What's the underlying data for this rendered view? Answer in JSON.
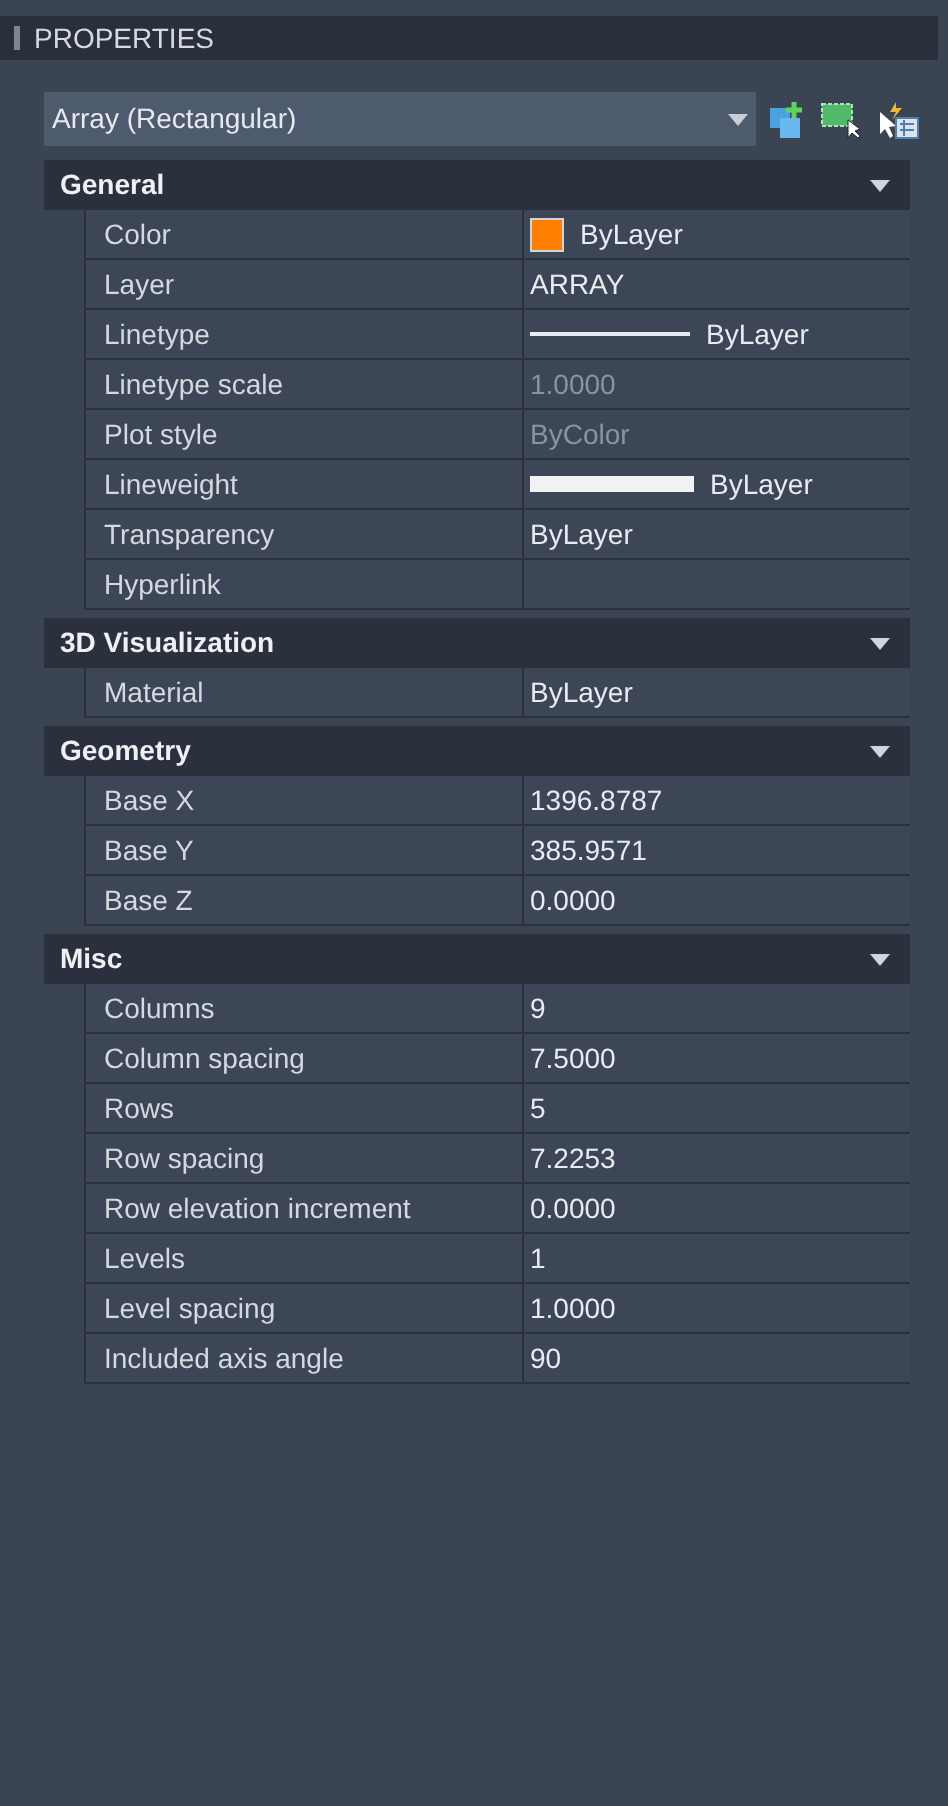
{
  "panel": {
    "title": "PROPERTIES"
  },
  "selector": {
    "value": "Array (Rectangular)"
  },
  "sections": [
    {
      "title": "General",
      "expanded": true,
      "rows": [
        {
          "label": "Color",
          "kind": "swatch",
          "value": "ByLayer",
          "color": "#ff7f00"
        },
        {
          "label": "Layer",
          "kind": "text",
          "value": "ARRAY"
        },
        {
          "label": "Linetype",
          "kind": "linetype",
          "value": "ByLayer"
        },
        {
          "label": "Linetype scale",
          "kind": "text",
          "value": "1.0000",
          "disabled": true
        },
        {
          "label": "Plot style",
          "kind": "text",
          "value": "ByColor",
          "disabled": true
        },
        {
          "label": "Lineweight",
          "kind": "lineweight",
          "value": "ByLayer"
        },
        {
          "label": "Transparency",
          "kind": "text",
          "value": "ByLayer"
        },
        {
          "label": "Hyperlink",
          "kind": "text"
        }
      ]
    },
    {
      "title": "3D Visualization",
      "expanded": true,
      "rows": [
        {
          "label": "Material",
          "kind": "text",
          "value": "ByLayer"
        }
      ]
    },
    {
      "title": "Geometry",
      "expanded": true,
      "rows": [
        {
          "label": "Base X",
          "kind": "text",
          "value": "1396.8787"
        },
        {
          "label": "Base Y",
          "kind": "text",
          "value": "385.9571"
        },
        {
          "label": "Base Z",
          "kind": "text",
          "value": "0.0000"
        }
      ]
    },
    {
      "title": "Misc",
      "expanded": true,
      "rows": [
        {
          "label": "Columns",
          "kind": "text",
          "value": "9"
        },
        {
          "label": "Column spacing",
          "kind": "text",
          "value": "7.5000"
        },
        {
          "label": "Rows",
          "kind": "text",
          "value": "5"
        },
        {
          "label": "Row spacing",
          "kind": "text",
          "value": "7.2253"
        },
        {
          "label": "Row elevation increment",
          "kind": "text",
          "value": "0.0000"
        },
        {
          "label": "Levels",
          "kind": "text",
          "value": "1"
        },
        {
          "label": "Level spacing",
          "kind": "text",
          "value": "1.0000"
        },
        {
          "label": "Included axis angle",
          "kind": "text",
          "value": "90"
        }
      ]
    }
  ]
}
